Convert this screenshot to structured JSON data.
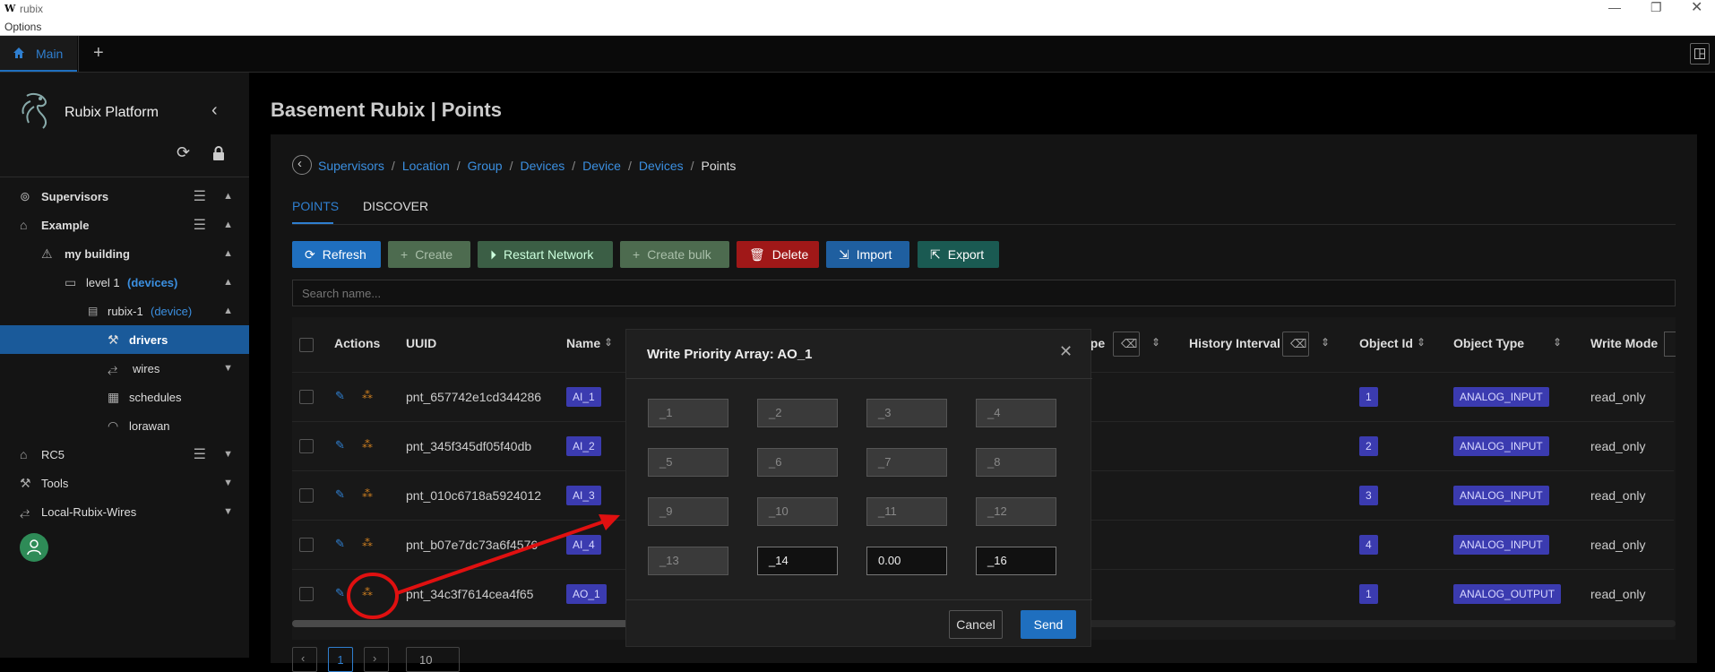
{
  "window": {
    "app_logo": "W",
    "title": "rubix",
    "menu": "Options"
  },
  "tabs": {
    "main_label": "Main",
    "add_label": "+"
  },
  "sidebar": {
    "brand": "Rubix Platform",
    "items": [
      {
        "label": "Supervisors"
      },
      {
        "label": "Example"
      },
      {
        "label": "my building"
      },
      {
        "label": "level 1",
        "tag": "(devices)"
      },
      {
        "label": "rubix-1",
        "tag": "(device)"
      },
      {
        "label": "drivers"
      },
      {
        "label": "wires"
      },
      {
        "label": "schedules"
      },
      {
        "label": "lorawan"
      },
      {
        "label": "RC5"
      },
      {
        "label": "Tools"
      },
      {
        "label": "Local-Rubix-Wires"
      }
    ]
  },
  "page": {
    "title": "Basement Rubix | Points"
  },
  "breadcrumb": {
    "items": [
      "Supervisors",
      "Location",
      "Group",
      "Devices",
      "Device",
      "Devices"
    ],
    "current": "Points",
    "sep": "/"
  },
  "view_tabs": {
    "points": "POINTS",
    "discover": "DISCOVER"
  },
  "toolbar": {
    "refresh": "Refresh",
    "create": "Create",
    "restart": "Restart Network",
    "create_bulk": "Create bulk",
    "delete": "Delete",
    "import": "Import",
    "export": "Export"
  },
  "search": {
    "placeholder": "Search name..."
  },
  "table": {
    "headers": {
      "actions": "Actions",
      "uuid": "UUID",
      "name": "Name",
      "type_partial": "ype",
      "history_interval": "History Interval",
      "object_id": "Object Id",
      "object_type": "Object Type",
      "write_mode": "Write Mode"
    },
    "rows": [
      {
        "uuid": "pnt_657742e1cd344286",
        "name": "AI_1",
        "object_id": "1",
        "object_type": "ANALOG_INPUT",
        "write_mode": "read_only"
      },
      {
        "uuid": "pnt_345f345df05f40db",
        "name": "AI_2",
        "object_id": "2",
        "object_type": "ANALOG_INPUT",
        "write_mode": "read_only"
      },
      {
        "uuid": "pnt_010c6718a5924012",
        "name": "AI_3",
        "object_id": "3",
        "object_type": "ANALOG_INPUT",
        "write_mode": "read_only"
      },
      {
        "uuid": "pnt_b07e7dc73a6f4576",
        "name": "AI_4",
        "object_id": "4",
        "object_type": "ANALOG_INPUT",
        "write_mode": "read_only"
      },
      {
        "uuid": "pnt_34c3f7614cea4f65",
        "name": "AO_1",
        "object_id": "1",
        "object_type": "ANALOG_OUTPUT",
        "write_mode": "read_only"
      }
    ]
  },
  "pagination": {
    "current_page": "1",
    "page_size": "10"
  },
  "modal": {
    "title": "Write Priority Array: AO_1",
    "fields": [
      "_1",
      "_2",
      "_3",
      "_4",
      "_5",
      "_6",
      "_7",
      "_8",
      "_9",
      "_10",
      "_11",
      "_12",
      "_13",
      "_14",
      "0.00",
      "_16"
    ],
    "cancel": "Cancel",
    "send": "Send"
  },
  "colors": {
    "accent": "#1f6fbf",
    "create_green": "#4d6b4f",
    "restart_green": "#3b5e45",
    "delete_red": "#a01818",
    "import_blue": "#1f5fa0",
    "export_teal": "#1a5a52",
    "annotation_red": "#e01010"
  }
}
